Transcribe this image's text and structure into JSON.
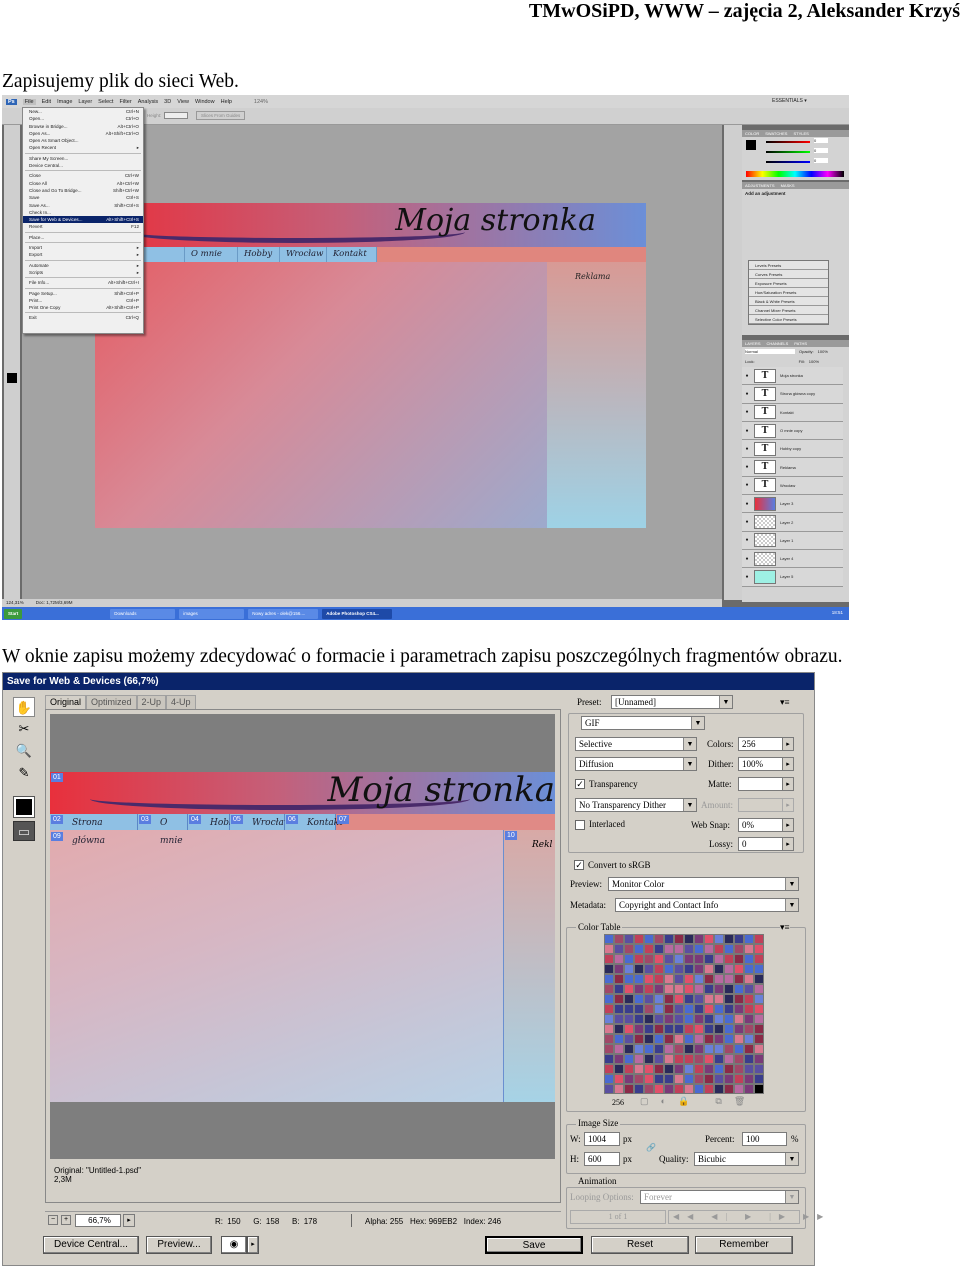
{
  "page_header": "TMwOSiPD, WWW – zajęcia 2, Aleksander Krzyś",
  "caption1": "Zapisujemy plik do sieci Web.",
  "caption2": "W oknie zapisu możemy zdecydować o formacie i parametrach zapisu poszczególnych fragmentów obrazu.",
  "photoshop": {
    "logo": "Ps",
    "menu": [
      "File",
      "Edit",
      "Image",
      "Layer",
      "Select",
      "Filter",
      "Analysis",
      "3D",
      "View",
      "Window",
      "Help"
    ],
    "zoom": "124%",
    "workspace": "ESSENTIALS ▾",
    "options": {
      "height_label": "Height:",
      "button": "Slices From Guides"
    },
    "file_menu": [
      {
        "label": "New...",
        "shortcut": "Ctrl+N"
      },
      {
        "label": "Open...",
        "shortcut": "Ctrl+O"
      },
      {
        "label": "Browse in Bridge...",
        "shortcut": "Alt+Ctrl+O"
      },
      {
        "label": "Open As...",
        "shortcut": "Alt+Shift+Ctrl+O"
      },
      {
        "label": "Open As Smart Object...",
        "shortcut": ""
      },
      {
        "label": "Open Recent",
        "shortcut": "▸"
      },
      {
        "sep": true
      },
      {
        "label": "Share My Screen...",
        "shortcut": ""
      },
      {
        "label": "Device Central...",
        "shortcut": ""
      },
      {
        "sep": true
      },
      {
        "label": "Close",
        "shortcut": "Ctrl+W"
      },
      {
        "label": "Close All",
        "shortcut": "Alt+Ctrl+W"
      },
      {
        "label": "Close and Go To Bridge...",
        "shortcut": "Shift+Ctrl+W"
      },
      {
        "label": "Save",
        "shortcut": "Ctrl+S"
      },
      {
        "label": "Save As...",
        "shortcut": "Shift+Ctrl+S"
      },
      {
        "label": "Check In...",
        "shortcut": ""
      },
      {
        "label": "Save for Web & Devices...",
        "shortcut": "Alt+Shift+Ctrl+S",
        "selected": true
      },
      {
        "label": "Revert",
        "shortcut": "F12"
      },
      {
        "sep": true
      },
      {
        "label": "Place...",
        "shortcut": ""
      },
      {
        "sep": true
      },
      {
        "label": "Import",
        "shortcut": "▸"
      },
      {
        "label": "Export",
        "shortcut": "▸"
      },
      {
        "sep": true
      },
      {
        "label": "Automate",
        "shortcut": "▸"
      },
      {
        "label": "Scripts",
        "shortcut": "▸"
      },
      {
        "sep": true
      },
      {
        "label": "File Info...",
        "shortcut": "Alt+Shift+Ctrl+I"
      },
      {
        "sep": true
      },
      {
        "label": "Page Setup...",
        "shortcut": "Shift+Ctrl+P"
      },
      {
        "label": "Print...",
        "shortcut": "Ctrl+P"
      },
      {
        "label": "Print One Copy",
        "shortcut": "Alt+Shift+Ctrl+P"
      },
      {
        "sep": true
      },
      {
        "label": "Exit",
        "shortcut": "Ctrl+Q"
      }
    ],
    "document": {
      "title": "Moja stronka",
      "nav": [
        "główna",
        "O mnie",
        "Hobby",
        "Wrocław",
        "Kontakt"
      ],
      "side": "Reklama"
    },
    "color_panel": {
      "tabs": [
        "COLOR",
        "SWATCHES",
        "STYLES"
      ],
      "values": [
        "0",
        "0",
        "0"
      ]
    },
    "adjustments": {
      "tabs": [
        "ADJUSTMENTS",
        "MASKS"
      ],
      "heading": "Add an adjustment",
      "presets": [
        "Levels Presets",
        "Curves Presets",
        "Exposure Presets",
        "Hue/Saturation Presets",
        "Black & White Presets",
        "Channel Mixer Presets",
        "Selective Color Presets"
      ]
    },
    "layers": {
      "tabs": [
        "LAYERS",
        "CHANNELS",
        "PATHS"
      ],
      "blend": "Normal",
      "opacity_label": "Opacity:",
      "opacity": "100%",
      "lock_label": "Lock:",
      "fill_label": "Fill:",
      "fill": "100%",
      "items": [
        {
          "name": "Moja stronka",
          "type": "text"
        },
        {
          "name": "Strona główna copy",
          "type": "text"
        },
        {
          "name": "Kontakt",
          "type": "text"
        },
        {
          "name": "O mnie copy",
          "type": "text"
        },
        {
          "name": "Hobby copy",
          "type": "text"
        },
        {
          "name": "Reklama",
          "type": "text"
        },
        {
          "name": "Wrocław",
          "type": "text"
        },
        {
          "name": "Layer 3",
          "type": "gradient"
        },
        {
          "name": "Layer 2",
          "type": "checker"
        },
        {
          "name": "Layer 1",
          "type": "checker"
        },
        {
          "name": "Layer 4",
          "type": "checker"
        },
        {
          "name": "Layer 5",
          "type": "aqua"
        }
      ]
    },
    "status": {
      "zoom": "124,31%",
      "doc": "Doc: 1,72M/3,69M"
    },
    "taskbar": {
      "start": "Start",
      "tasks": [
        "Downloads",
        "images",
        "Nowy adres - olek@156....",
        "Adobe Photoshop CS4..."
      ],
      "clock": "18:51"
    }
  },
  "dialog": {
    "title": "Save for Web & Devices (66,7%)",
    "tabs": [
      "Original",
      "Optimized",
      "2-Up",
      "4-Up"
    ],
    "image": {
      "title": "Moja stronka",
      "nav": [
        {
          "slice": "02",
          "label": "Strona główna"
        },
        {
          "slice": "03",
          "label": "O mnie"
        },
        {
          "slice": "04",
          "label": "Hobby"
        },
        {
          "slice": "05",
          "label": "Wrocław"
        },
        {
          "slice": "06",
          "label": "Kontakt"
        },
        {
          "slice": "07",
          "label": ""
        }
      ],
      "slice_banner": "01",
      "slice_content": "09",
      "slice_side": "10",
      "side": "Rekl"
    },
    "info": {
      "original": "Original: \"Untitled-1.psd\"",
      "size": "2,3M"
    },
    "preset_label": "Preset:",
    "preset": "[Unnamed]",
    "format": "GIF",
    "reduction": "Selective",
    "colors_label": "Colors:",
    "colors": "256",
    "dither_algo": "Diffusion",
    "dither_label": "Dither:",
    "dither": "100%",
    "transparency": "Transparency",
    "transparency_checked": true,
    "matte_label": "Matte:",
    "trans_dither": "No Transparency Dither",
    "amount_label": "Amount:",
    "interlaced": "Interlaced",
    "interlaced_checked": false,
    "websnap_label": "Web Snap:",
    "websnap": "0%",
    "lossy_label": "Lossy:",
    "lossy": "0",
    "srgb": "Convert to sRGB",
    "srgb_checked": true,
    "preview_label": "Preview:",
    "preview": "Monitor Color",
    "metadata_label": "Metadata:",
    "metadata": "Copyright and Contact Info",
    "color_table_label": "Color Table",
    "color_count": "256",
    "image_size": {
      "label": "Image Size",
      "w_label": "W:",
      "w": "1004",
      "h_label": "H:",
      "h": "600",
      "unit": "px",
      "percent_label": "Percent:",
      "percent": "100",
      "pct": "%",
      "quality_label": "Quality:",
      "quality": "Bicubic"
    },
    "animation": {
      "label": "Animation",
      "looping_label": "Looping Options:",
      "looping": "Forever",
      "frame": "1 of 1"
    },
    "zoom": "66,7%",
    "pixel": {
      "r": "R: 150",
      "g": "G: 158",
      "b": "B: 178",
      "alpha": "Alpha: 255",
      "hex": "Hex: 969EB2",
      "index": "Index: 246"
    },
    "buttons": {
      "device_central": "Device Central...",
      "preview": "Preview...",
      "save": "Save",
      "reset": "Reset",
      "remember": "Remember"
    }
  }
}
